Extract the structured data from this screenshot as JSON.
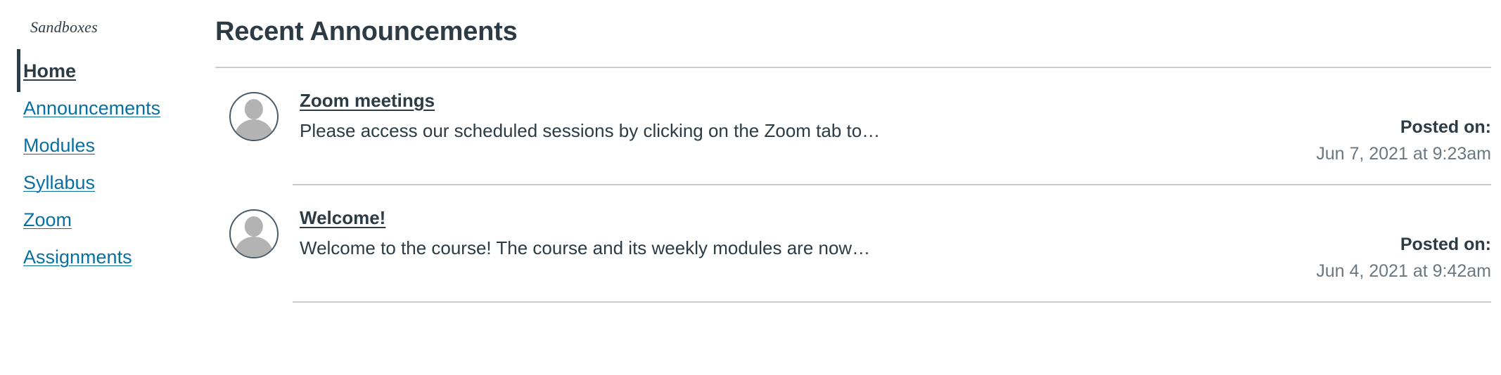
{
  "course": {
    "name": "Sandboxes"
  },
  "sidebar": {
    "items": [
      {
        "label": "Home",
        "active": true
      },
      {
        "label": "Announcements",
        "active": false
      },
      {
        "label": "Modules",
        "active": false
      },
      {
        "label": "Syllabus",
        "active": false
      },
      {
        "label": "Zoom",
        "active": false
      },
      {
        "label": "Assignments",
        "active": false
      }
    ]
  },
  "main": {
    "heading": "Recent Announcements",
    "posted_label": "Posted on:",
    "announcements": [
      {
        "author_avatar": "user-avatar-placeholder-icon",
        "title": "Zoom meetings",
        "excerpt": "Please access our scheduled sessions by clicking on the Zoom tab to…",
        "posted_label": "Posted on:",
        "posted_date": "Jun 7, 2021 at 9:23am"
      },
      {
        "author_avatar": "user-avatar-placeholder-icon",
        "title": "Welcome!",
        "excerpt": "Welcome to the course! The course and its weekly modules are now…",
        "posted_label": "Posted on:",
        "posted_date": "Jun 4, 2021 at 9:42am"
      }
    ]
  },
  "colors": {
    "link": "#0770A3",
    "text": "#2D3B45",
    "muted": "#6B7780",
    "divider": "#C7CDD1",
    "avatar_border": "#4A5B68",
    "avatar_fill": "#B3B3B3"
  }
}
